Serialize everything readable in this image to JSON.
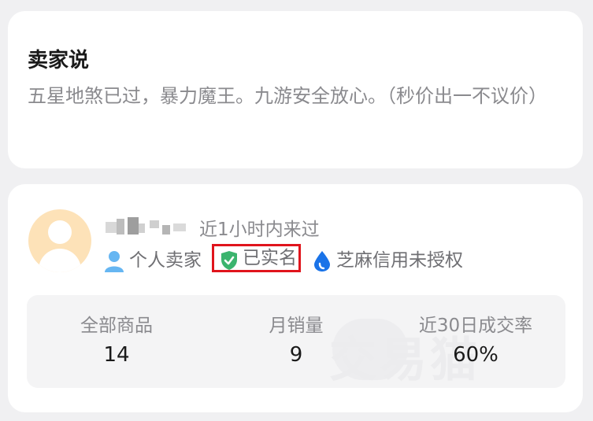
{
  "seller_says": {
    "title": "卖家说",
    "text": "五星地煞已过，暴力魔王。九游安全放心。（秒价出一不议价）"
  },
  "seller": {
    "last_seen": "近1小时内来过",
    "tags": {
      "personal": "个人卖家",
      "verified": "已实名",
      "zhima": "芝麻信用未授权"
    },
    "stats": [
      {
        "label": "全部商品",
        "value": "14"
      },
      {
        "label": "月销量",
        "value": "9"
      },
      {
        "label": "近30日成交率",
        "value": "60%"
      }
    ],
    "watermark": "交易猫"
  },
  "colors": {
    "accent_green": "#3bb46e",
    "accent_blue": "#1a73e8",
    "highlight_red": "#e0141c",
    "avatar_bg": "#fde2b8"
  },
  "icons": {
    "personal": "user-icon",
    "verified": "shield-check-icon",
    "zhima": "water-drop-icon"
  }
}
